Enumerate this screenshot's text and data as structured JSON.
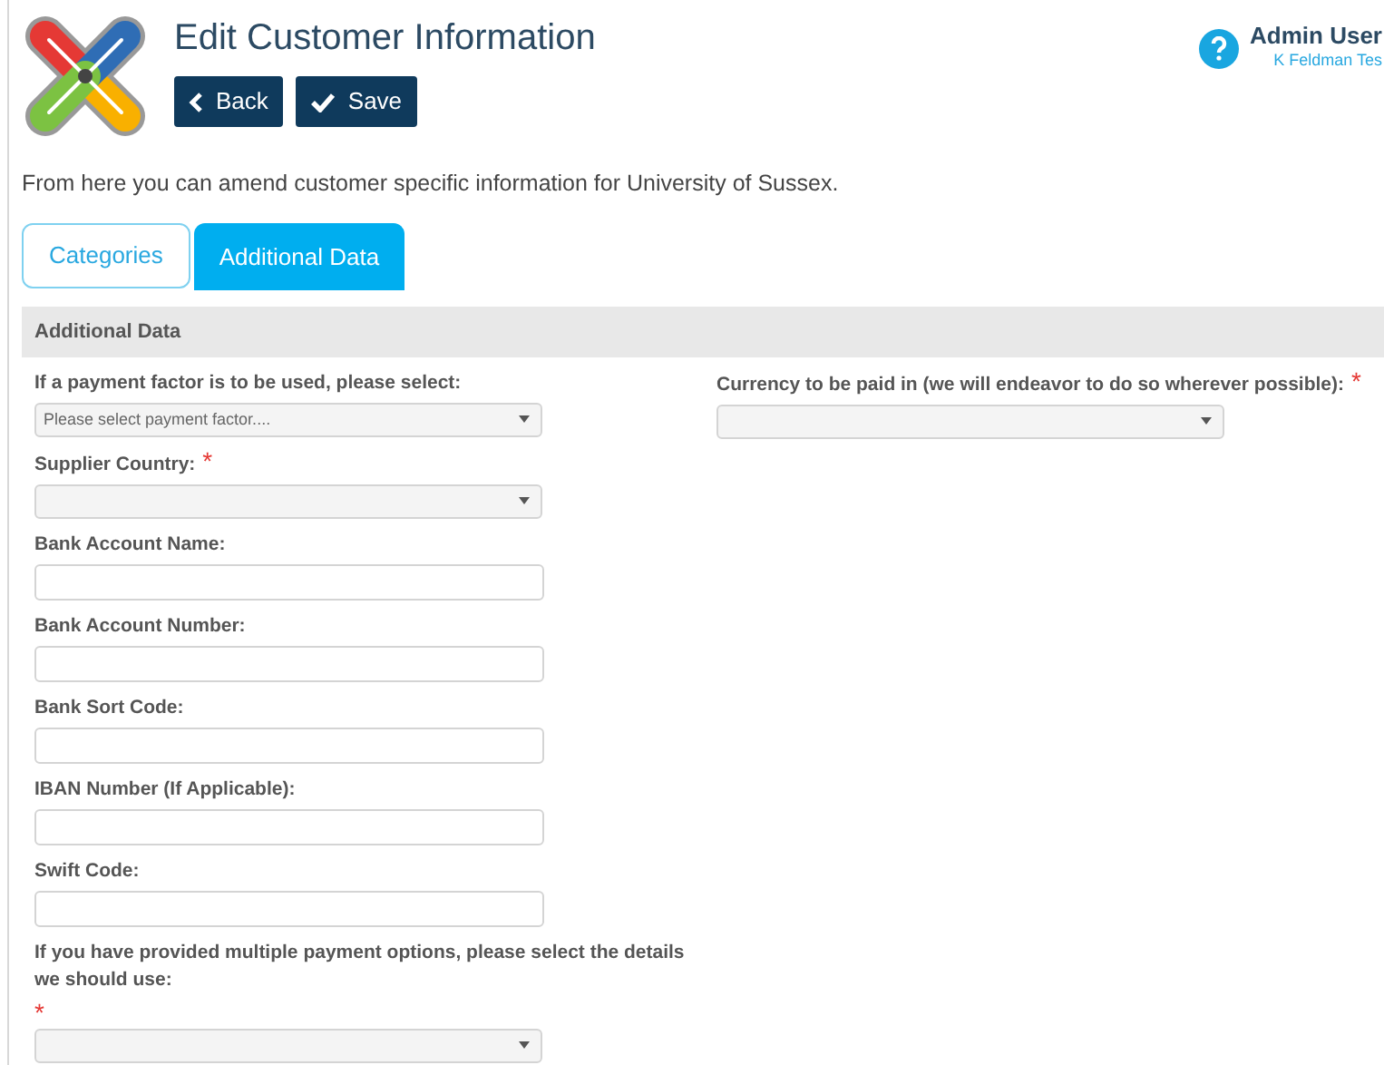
{
  "header": {
    "title": "Edit Customer Information",
    "buttons": [
      {
        "kind": "back",
        "label": "Back"
      },
      {
        "kind": "save",
        "label": "Save"
      }
    ],
    "user": {
      "name": "Admin User",
      "subtitle": "K Feldman Tes"
    }
  },
  "intro": "From here you can amend customer specific information for University of Sussex.",
  "tabs": [
    {
      "label": "Categories",
      "selected": false
    },
    {
      "label": "Additional Data",
      "selected": true
    }
  ],
  "panel": {
    "title": "Additional Data",
    "left_fields": [
      {
        "kind": "select",
        "label": "If a payment factor is to be used, please select:",
        "placeholder": "Please select payment factor...."
      },
      {
        "kind": "select",
        "label": "Supplier Country:",
        "required_mark": "*"
      },
      {
        "kind": "text",
        "label": "Bank Account Name:"
      },
      {
        "kind": "text",
        "label": "Bank Account Number:"
      },
      {
        "kind": "text",
        "label": "Bank Sort Code:"
      },
      {
        "kind": "text",
        "label": "IBAN Number (If Applicable):"
      },
      {
        "kind": "text",
        "label": "Swift Code:"
      },
      {
        "kind": "select",
        "label": "If you have provided multiple payment options, please select the details we should use:",
        "required_mark": "*"
      }
    ],
    "right_fields": [
      {
        "kind": "select",
        "label": "Currency to be paid in (we will endeavor to do so wherever possible):",
        "required_mark": "*"
      }
    ]
  }
}
